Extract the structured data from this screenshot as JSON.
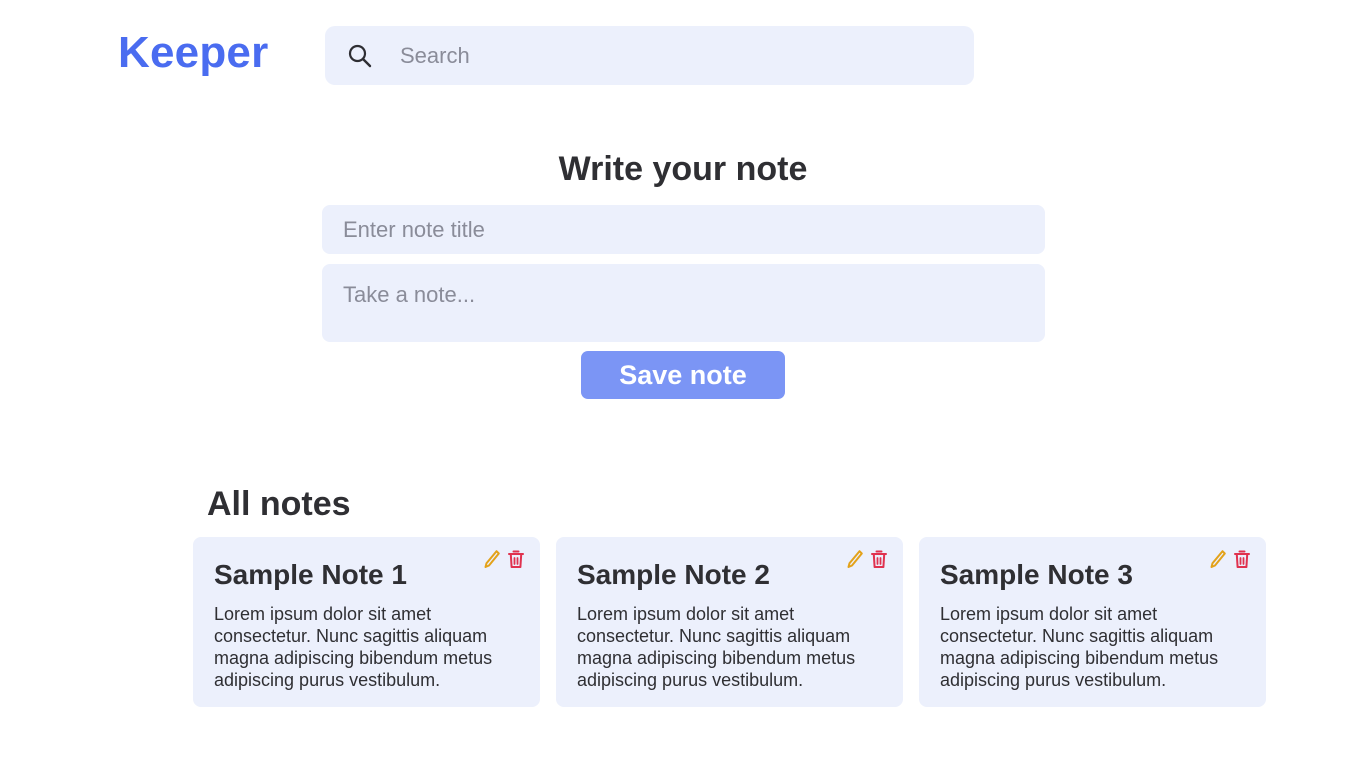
{
  "app": {
    "logo": "Keeper"
  },
  "search": {
    "placeholder": "Search",
    "icon": "search-icon"
  },
  "editor": {
    "heading": "Write your note",
    "title_placeholder": "Enter note title",
    "body_placeholder": "Take a note...",
    "save_label": "Save note"
  },
  "notes_section": {
    "heading": "All notes",
    "notes": [
      {
        "title": "Sample Note 1",
        "body": "Lorem ipsum dolor sit amet consectetur. Nunc sagittis aliquam magna adipiscing bibendum metus adipiscing purus vestibulum."
      },
      {
        "title": "Sample Note 2",
        "body": "Lorem ipsum dolor sit amet consectetur. Nunc sagittis aliquam magna adipiscing bibendum metus adipiscing purus vestibulum."
      },
      {
        "title": "Sample Note 3",
        "body": "Lorem ipsum dolor sit amet consectetur. Nunc sagittis aliquam magna adipiscing bibendum metus adipiscing purus vestibulum."
      }
    ]
  },
  "colors": {
    "brand": "#4a6cf0",
    "button": "#7b95f5",
    "field_bg": "#ecf0fc",
    "edit_icon": "#e3a21a",
    "delete_icon": "#e0324f"
  }
}
